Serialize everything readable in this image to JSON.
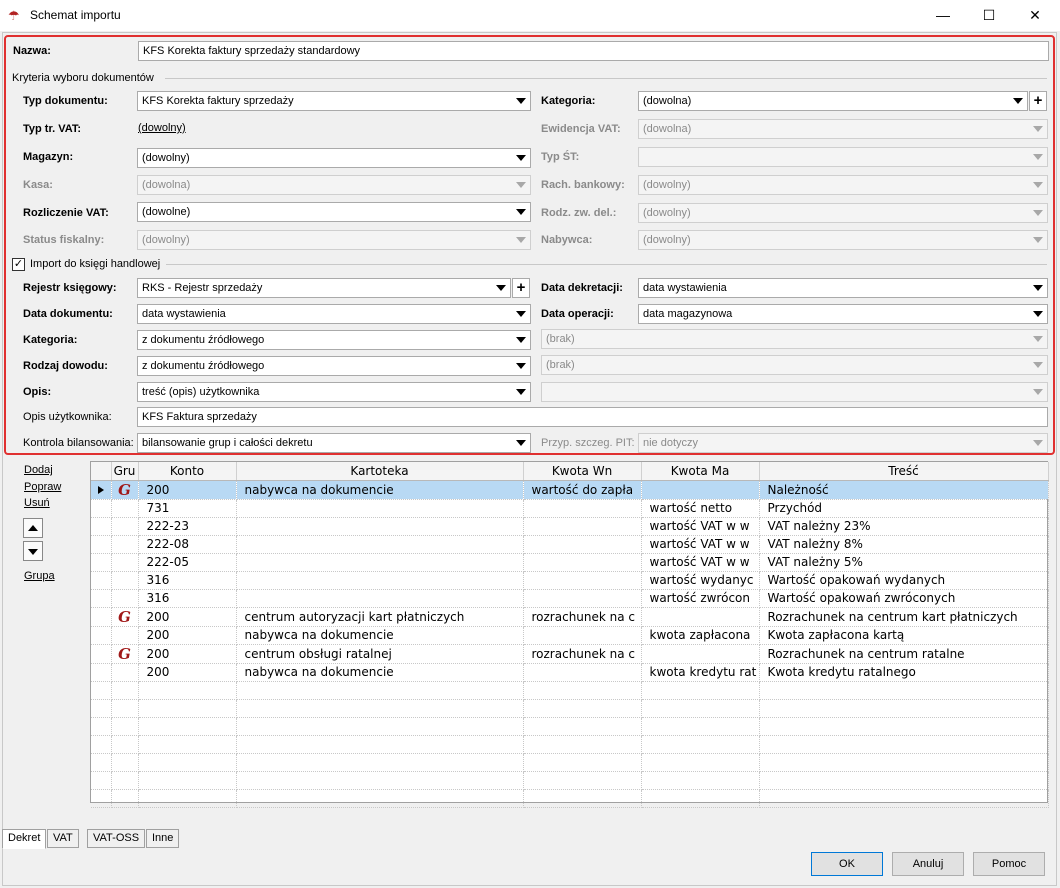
{
  "window": {
    "title": "Schemat importu",
    "minimize": "—",
    "maximize": "☐",
    "close": "✕"
  },
  "nazwa": {
    "label": "Nazwa:",
    "value": "KFS Korekta faktury sprzedaży standardowy"
  },
  "criteria": {
    "section_label": "Kryteria wyboru dokumentów",
    "typ_dokumentu": {
      "label": "Typ dokumentu:",
      "value": "KFS Korekta faktury sprzedaży"
    },
    "kategoria": {
      "label": "Kategoria:",
      "value": "(dowolna)"
    },
    "typ_tr_vat": {
      "label": "Typ tr. VAT:",
      "value": "(dowolny)"
    },
    "ewidencja_vat": {
      "label": "Ewidencja VAT:",
      "value": "(dowolna)"
    },
    "magazyn": {
      "label": "Magazyn:",
      "value": "(dowolny)"
    },
    "typ_st": {
      "label": "Typ ŚT:",
      "value": ""
    },
    "kasa": {
      "label": "Kasa:",
      "value": "(dowolna)"
    },
    "rach_bankowy": {
      "label": "Rach. bankowy:",
      "value": "(dowolny)"
    },
    "rozliczenie_vat": {
      "label": "Rozliczenie VAT:",
      "value": "(dowolne)"
    },
    "rodz_zw_del": {
      "label": "Rodz. zw. del.:",
      "value": "(dowolny)"
    },
    "status_fiskalny": {
      "label": "Status fiskalny:",
      "value": "(dowolny)"
    },
    "nabywca": {
      "label": "Nabywca:",
      "value": "(dowolny)"
    }
  },
  "import": {
    "checkbox_label": "Import do księgi handlowej",
    "checked_mark": "✓",
    "rejestr": {
      "label": "Rejestr księgowy:",
      "value": "RKS - Rejestr sprzedaży"
    },
    "data_dekretacji": {
      "label": "Data dekretacji:",
      "value": "data wystawienia"
    },
    "data_dokumentu": {
      "label": "Data dokumentu:",
      "value": "data wystawienia"
    },
    "data_operacji": {
      "label": "Data operacji:",
      "value": "data magazynowa"
    },
    "kategoria": {
      "label": "Kategoria:",
      "value": "z dokumentu źródłowego",
      "right_value": "(brak)"
    },
    "rodzaj_dowodu": {
      "label": "Rodzaj dowodu:",
      "value": "z dokumentu źródłowego",
      "right_value": "(brak)"
    },
    "opis": {
      "label": "Opis:",
      "value": "treść (opis) użytkownika",
      "right_value": ""
    },
    "opis_uzytkownika": {
      "label": "Opis użytkownika:",
      "value": "KFS Faktura sprzedaży"
    },
    "kontrola": {
      "label": "Kontrola bilansowania:",
      "value": "bilansowanie grup i całości dekretu"
    },
    "przyp_pit": {
      "label": "Przyp. szczeg. PIT:",
      "value": "nie dotyczy"
    }
  },
  "side_actions": {
    "dodaj": "Dodaj",
    "popraw": "Popraw",
    "usun": "Usuń",
    "grupa": "Grupa"
  },
  "grid": {
    "columns": [
      "",
      "Gru",
      "Konto",
      "Kartoteka",
      "Kwota Wn",
      "Kwota Ma",
      "Treść"
    ],
    "group_glyph": "G",
    "rows": [
      {
        "group": true,
        "konto": "200",
        "kartoteka": "nabywca na dokumencie",
        "wn": "wartość do zapła",
        "ma": "",
        "tresc": "Należność",
        "selected": true
      },
      {
        "group": false,
        "konto": "731",
        "kartoteka": "",
        "wn": "",
        "ma": "wartość netto",
        "tresc": "Przychód"
      },
      {
        "group": false,
        "konto": "222-23",
        "kartoteka": "",
        "wn": "",
        "ma": "wartość VAT w w",
        "tresc": "VAT należny 23%"
      },
      {
        "group": false,
        "konto": "222-08",
        "kartoteka": "",
        "wn": "",
        "ma": "wartość VAT w w",
        "tresc": "VAT należny 8%"
      },
      {
        "group": false,
        "konto": "222-05",
        "kartoteka": "",
        "wn": "",
        "ma": "wartość VAT w w",
        "tresc": "VAT należny 5%"
      },
      {
        "group": false,
        "konto": "316",
        "kartoteka": "",
        "wn": "",
        "ma": "wartość wydanyc",
        "tresc": "Wartość opakowań wydanych"
      },
      {
        "group": false,
        "konto": "316",
        "kartoteka": "",
        "wn": "",
        "ma": "wartość zwrócon",
        "tresc": "Wartość opakowań zwróconych"
      },
      {
        "group": true,
        "konto": "200",
        "kartoteka": "centrum autoryzacji kart płatniczych",
        "wn": "rozrachunek na c",
        "ma": "",
        "tresc": "Rozrachunek na centrum kart płatniczych"
      },
      {
        "group": false,
        "konto": "200",
        "kartoteka": "nabywca na dokumencie",
        "wn": "",
        "ma": "kwota zapłacona",
        "tresc": "Kwota zapłacona kartą"
      },
      {
        "group": true,
        "konto": "200",
        "kartoteka": "centrum obsługi ratalnej",
        "wn": "rozrachunek na c",
        "ma": "",
        "tresc": "Rozrachunek na centrum ratalne"
      },
      {
        "group": false,
        "konto": "200",
        "kartoteka": "nabywca na dokumencie",
        "wn": "",
        "ma": "kwota kredytu rat",
        "tresc": "Kwota kredytu ratalnego"
      }
    ]
  },
  "tabs": [
    "Dekret",
    "VAT",
    "VAT-OSS",
    "Inne"
  ],
  "buttons": {
    "ok": "OK",
    "anuluj": "Anuluj",
    "pomoc": "Pomoc"
  }
}
